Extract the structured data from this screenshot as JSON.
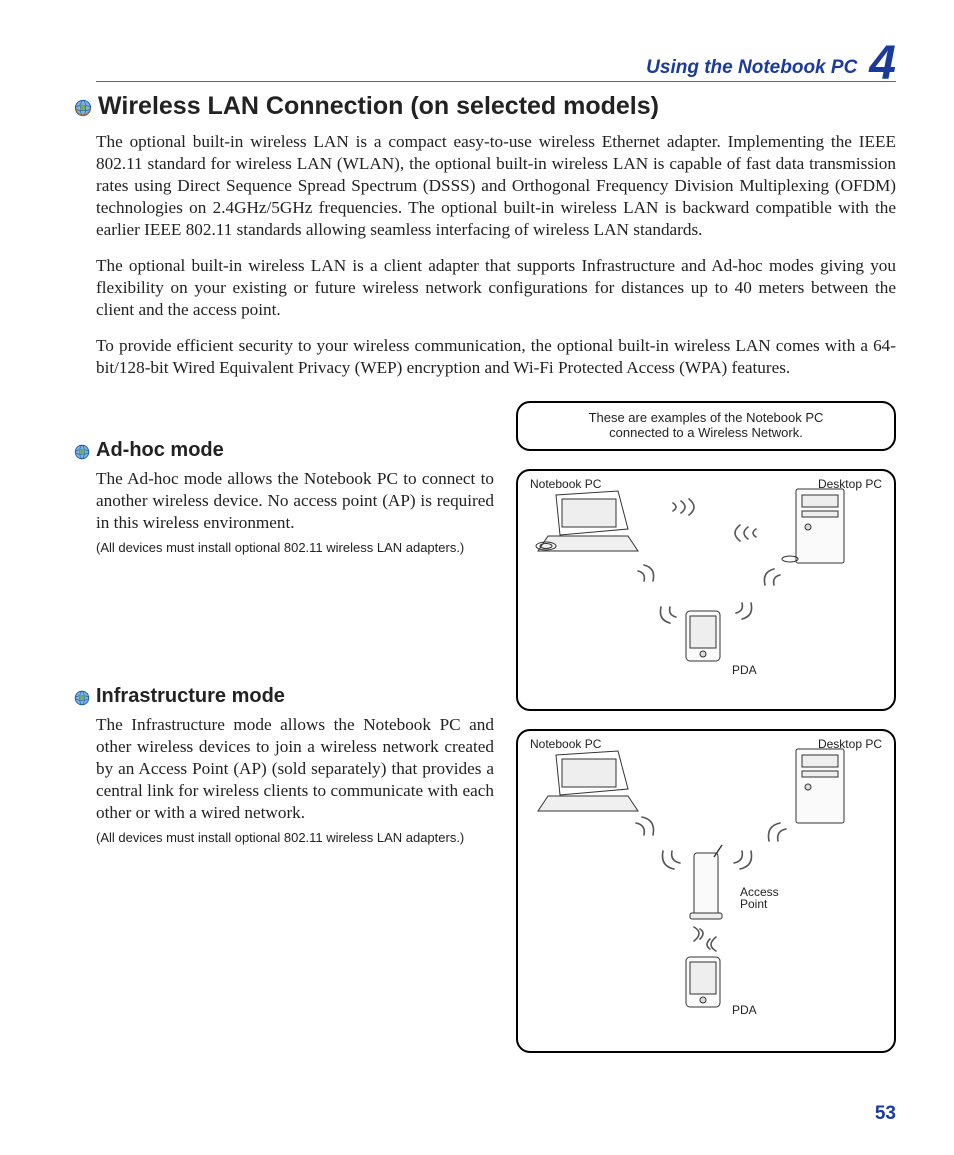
{
  "header": {
    "title": "Using the Notebook PC",
    "chapter": "4"
  },
  "section": {
    "title": "Wireless LAN Connection (on selected models)",
    "paras": [
      "The optional built-in wireless LAN is a compact easy-to-use wireless Ethernet adapter. Implementing the IEEE 802.11 standard for wireless LAN (WLAN), the optional built-in wireless LAN is capable of fast data transmission rates using Direct Sequence Spread Spectrum (DSSS) and Orthogonal Frequency Division Multiplexing (OFDM) technologies on 2.4GHz/5GHz frequencies. The optional built-in wireless LAN is backward compatible with the earlier IEEE 802.11 standards allowing seamless interfacing of wireless LAN standards.",
      "The optional built-in wireless LAN is a client adapter that supports Infrastructure and Ad-hoc modes giving you flexibility on your existing or future wireless network configurations for distances up to 40 meters between the client and the access point.",
      "To provide efficient security to your wireless communication, the optional built-in wireless LAN comes with a 64-bit/128-bit Wired Equivalent Privacy (WEP) encryption and Wi-Fi Protected Access (WPA) features."
    ]
  },
  "caption": {
    "line1": "These are examples of the Notebook PC",
    "line2": "connected to a Wireless Network."
  },
  "adhoc": {
    "title": "Ad-hoc mode",
    "para": "The Ad-hoc mode allows the Notebook PC to connect to another wireless device. No access point (AP) is required in this wireless environment.",
    "note": "(All devices must install optional 802.11 wireless LAN adapters.)"
  },
  "infra": {
    "title": "Infrastructure mode",
    "para": "The Infrastructure mode allows the Notebook PC and other wireless devices to join a wireless network created by an Access Point (AP) (sold separately) that provides a central link for wireless clients to communicate with each other or with a wired network.",
    "note": "(All devices must install optional 802.11 wireless LAN adapters.)"
  },
  "labels": {
    "notebook": "Notebook PC",
    "desktop": "Desktop PC",
    "pda": "PDA",
    "ap": "Access",
    "ap2": "Point"
  },
  "page_number": "53"
}
